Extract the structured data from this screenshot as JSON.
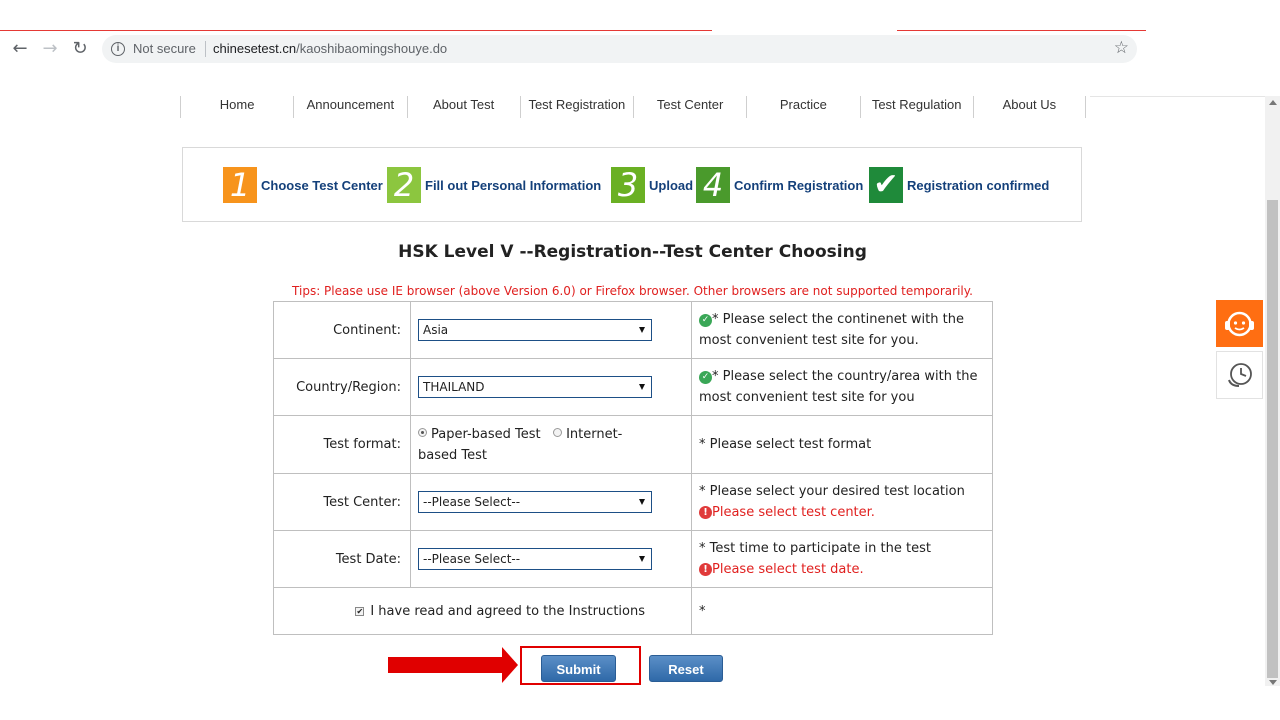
{
  "browser": {
    "security_label": "Not secure",
    "url_domain": "chinesetest.cn",
    "url_path": "/kaoshibaomingshouye.do"
  },
  "nav": {
    "items": [
      "Home",
      "Announcement",
      "About Test",
      "Test Registration",
      "Test Center",
      "Practice",
      "Test Regulation",
      "About Us"
    ]
  },
  "steps": [
    {
      "num": "1",
      "label": "Choose Test Center",
      "color": "#f7941d"
    },
    {
      "num": "2",
      "label": "Fill out Personal Information",
      "color": "#8cc63f"
    },
    {
      "num": "3",
      "label": "Upload",
      "color": "#6ab023"
    },
    {
      "num": "4",
      "label": "Confirm Registration",
      "color": "#4a9a2c"
    },
    {
      "num": "✔",
      "label": "Registration confirmed",
      "color": "#1f8a3a"
    }
  ],
  "page": {
    "title": "HSK Level V --Registration--Test Center Choosing",
    "tips": "Tips: Please use IE browser (above Version 6.0) or Firefox browser. Other browsers are not supported temporarily."
  },
  "form": {
    "continent": {
      "label": "Continent:",
      "value": "Asia",
      "hint": "* Please select the continenet with the most convenient test site for you."
    },
    "country": {
      "label": "Country/Region:",
      "value": "THAILAND",
      "hint": "* Please select the country/area with the most convenient test site for you"
    },
    "format": {
      "label": "Test format:",
      "option_paper": "Paper-based Test",
      "option_internet": "Internet-based Test",
      "hint": "* Please select test format",
      "selected": "paper"
    },
    "center": {
      "label": "Test Center:",
      "value": "--Please Select--",
      "hint": "* Please select your desired test location",
      "error": "Please select test center."
    },
    "date": {
      "label": "Test Date:",
      "value": "--Please Select--",
      "hint": "* Test time to participate in the test",
      "error": "Please select test date."
    },
    "agree": {
      "label": "I have read and agreed to the Instructions",
      "hint": "*",
      "checked": true
    }
  },
  "buttons": {
    "submit": "Submit",
    "reset": "Reset"
  },
  "colors": {
    "accent_red": "#e00000",
    "tips_red": "#e0201f",
    "step_text": "#14407a",
    "button_blue": "#2f69a8",
    "widget_orange": "#ff6e12"
  }
}
